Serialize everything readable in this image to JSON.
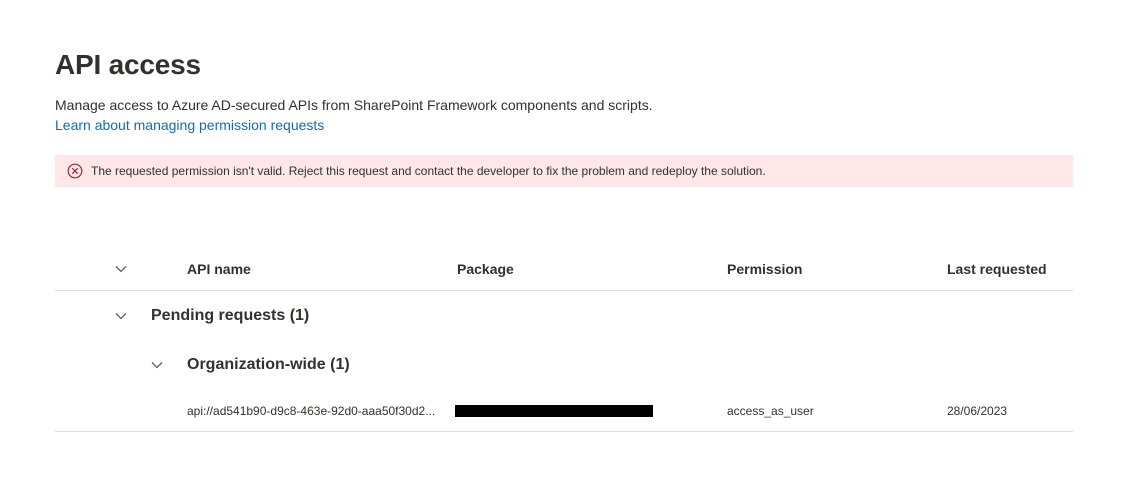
{
  "header": {
    "title": "API access",
    "description": "Manage access to Azure AD-secured APIs from SharePoint Framework components and scripts.",
    "learn_link": "Learn about managing permission requests"
  },
  "error": {
    "message": "The requested permission isn't valid. Reject this request and contact the developer to fix the problem and redeploy the solution.",
    "icon": "error-circle-icon",
    "background": "#fde7e9",
    "icon_color": "#a4262c"
  },
  "table": {
    "columns": {
      "api_name": "API name",
      "package": "Package",
      "permission": "Permission",
      "last_requested": "Last requested"
    },
    "groups": [
      {
        "label": "Pending requests (1)",
        "subgroups": [
          {
            "label": "Organization-wide (1)",
            "rows": [
              {
                "api_name": "api://ad541b90-d9c8-463e-92d0-aaa50f30d2...",
                "package": "",
                "permission": "access_as_user",
                "last_requested": "28/06/2023"
              }
            ]
          }
        ]
      }
    ]
  },
  "colors": {
    "link": "#0f6cbd",
    "text": "#323130",
    "divider": "#e1dfdd"
  }
}
